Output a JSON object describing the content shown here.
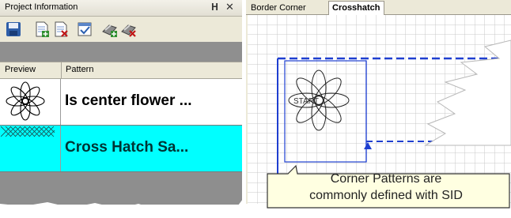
{
  "panel": {
    "title": "Project Information",
    "pin_glyph": "ᵮ",
    "close_glyph": "×"
  },
  "toolbar": {
    "icons": [
      "save-icon",
      "add-pattern-icon",
      "remove-pattern-icon",
      "properties-icon",
      "add-group-icon",
      "remove-group-icon"
    ]
  },
  "grid": {
    "columns": [
      "Preview",
      "Pattern"
    ],
    "rows": [
      {
        "pattern": "Is center flower ..."
      },
      {
        "pattern": "Cross Hatch Sa..."
      }
    ]
  },
  "tabs": [
    "Border Corner",
    "Crosshatch"
  ],
  "active_tab": "Crosshatch",
  "canvas": {
    "start_label": "START",
    "line_color": "#1f3fd0",
    "grid_color": "#c8c8c8"
  },
  "callout": {
    "line1": "Corner Patterns are",
    "line2": "commonly defined with SID"
  },
  "colors": {
    "selected_row": "#00ffff",
    "panel_bg": "#ece9d8"
  }
}
